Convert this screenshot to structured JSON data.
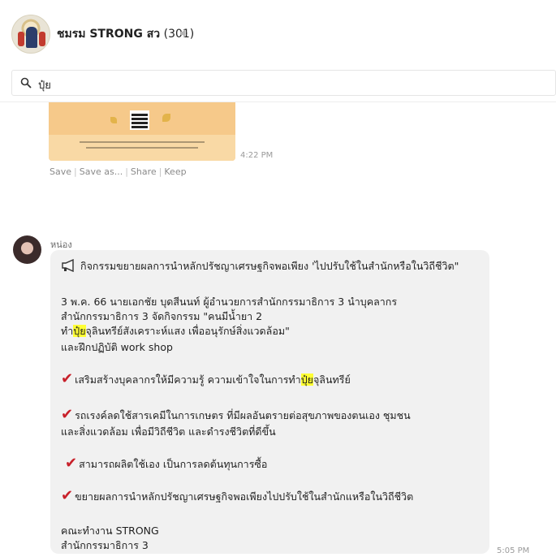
{
  "header": {
    "group_name": "ชมรม STRONG สว",
    "member_count": "(301)"
  },
  "search": {
    "value": "ปุ๋ย"
  },
  "image_message": {
    "time": "4:22 PM",
    "actions": [
      "Save",
      "Save as...",
      "Share",
      "Keep"
    ]
  },
  "message": {
    "sender": "หน่อง",
    "time": "5:05 PM",
    "title": "กิจกรรมขยายผลการนำหลักปรัชญาเศรษฐกิจพอเพียง 'ไปปรับใช้ในสำนักหรือในวิถีชีวิต\"",
    "para1_line1": "3 พ.ค. 66  นายเอกชัย บุดสีนนท์ ผู้อำนวยการสำนักกรรมาธิการ 3  นำบุคลากร",
    "para1_line2": "สำนักกรรมาธิการ 3 จัดกิจกรรม \"คนมีน้ำยา 2",
    "para1_line3_pre": "ทำ",
    "para1_line3_hl": "ปุ๋ย",
    "para1_line3_post": "จุลินทรีย์สังเคราะห์แสง เพื่ออนุรักษ์สิ่งแวดล้อม\"",
    "para1_line4": "และฝึกปฏิบัติ work shop",
    "bullet1_pre": "เสริมสร้างบุคลากรให้มีความรู้ ความเข้าใจในการทำ",
    "bullet1_hl": "ปุ๋ย",
    "bullet1_post": "จุลินทรีย์",
    "bullet2_line1": "รถเรงค์ลดใช้สารเคมีในการเกษตร ที่มีผลอันตรายต่อสุขภาพของตนเอง ชุมชน",
    "bullet2_line2": "และสิ่งแวดล้อม เพื่อมีวิถีชีวิต และดำรงชีวิตที่ดีขึ้น",
    "bullet3": "สามารถผลิตใช้เอง เป็นการลดต้นทุนการซื้อ",
    "bullet4": "ขยายผลการนำหลักปรัชญาเศรษฐกิจพอเพียงไปปรับใช้ในสำนักแหรือในวิถีชีวิต",
    "signature_line1": "คณะทำงาน STRONG",
    "signature_line2": "สำนักกรรมาธิการ 3",
    "check_glyph": "✔"
  },
  "colors": {
    "highlight": "#ffff33",
    "check": "#c8202a",
    "bubble": "#f1f1f1"
  }
}
